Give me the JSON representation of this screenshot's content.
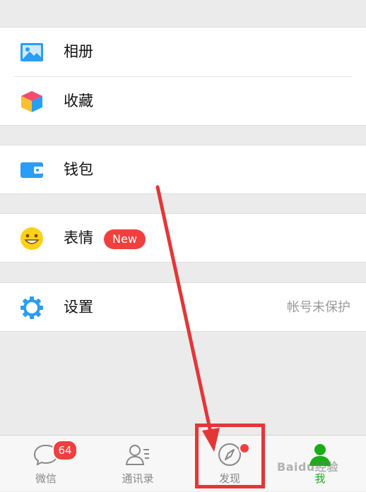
{
  "menu": {
    "album": {
      "label": "相册",
      "icon": "album-icon"
    },
    "favorites": {
      "label": "收藏",
      "icon": "favorites-cube-icon"
    },
    "wallet": {
      "label": "钱包",
      "icon": "wallet-icon"
    },
    "stickers": {
      "label": "表情",
      "badge": "New",
      "icon": "smiley-icon"
    },
    "settings": {
      "label": "设置",
      "status": "帐号未保护",
      "icon": "gear-icon"
    }
  },
  "tabbar": {
    "chats": {
      "label": "微信",
      "badge": "64",
      "icon": "chat-bubble-icon"
    },
    "contacts": {
      "label": "通讯录",
      "icon": "contacts-icon"
    },
    "discover": {
      "label": "发现",
      "icon": "compass-icon"
    },
    "me": {
      "label": "我",
      "icon": "person-icon"
    }
  },
  "watermark": "Baidu经验",
  "colors": {
    "accent_green": "#1aad19",
    "badge_red": "#f0403e",
    "annotation_red": "#e33638",
    "icon_blue": "#2a9df4"
  }
}
